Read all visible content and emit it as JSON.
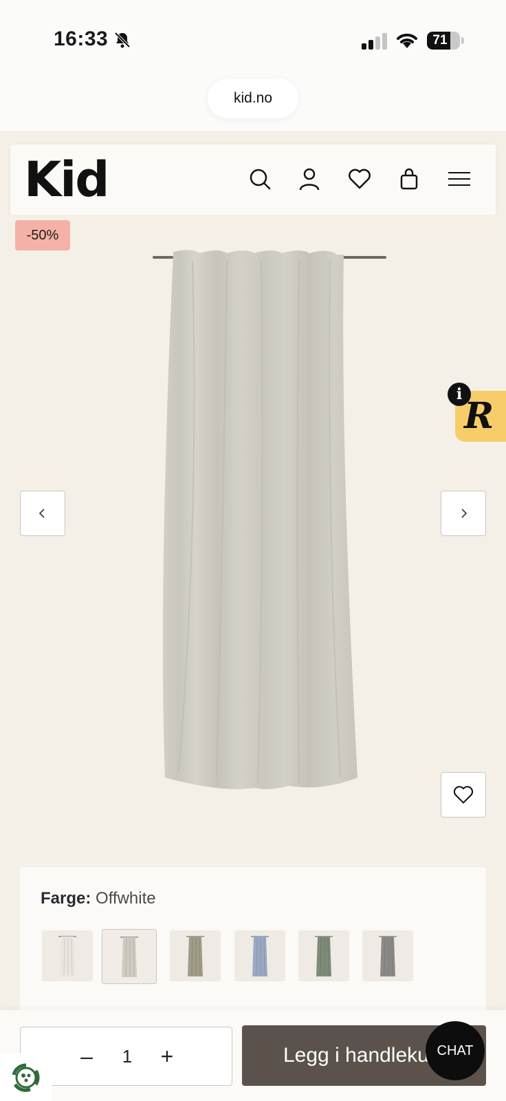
{
  "status_bar": {
    "time": "16:33",
    "battery": "71",
    "battery_level": 0.71
  },
  "browser": {
    "url": "kid.no"
  },
  "header": {
    "logo": "Kid",
    "icons": [
      "search-icon",
      "user-icon",
      "heart-icon",
      "bag-icon",
      "menu-icon"
    ]
  },
  "product": {
    "discount": "-50%",
    "color_label": "Farge:",
    "color_value": "Offwhite",
    "swatches": [
      {
        "name": "white",
        "color": "#e9e6e0"
      },
      {
        "name": "offwhite",
        "color": "#cfcbc1",
        "selected": true
      },
      {
        "name": "olive",
        "color": "#a09c88"
      },
      {
        "name": "blue",
        "color": "#9aa9c4"
      },
      {
        "name": "green",
        "color": "#7c8c78"
      },
      {
        "name": "grey",
        "color": "#8c8a86"
      }
    ]
  },
  "widgets": {
    "r_badge": "R",
    "info": "i"
  },
  "cart": {
    "quantity": "1",
    "minus": "–",
    "plus": "+",
    "add_label": "Legg i handlekurv",
    "chat": "CHAT"
  },
  "colors": {
    "accent": "#5b534b",
    "badge": "#f6b1a6",
    "r_widget": "#f7cd6a"
  }
}
